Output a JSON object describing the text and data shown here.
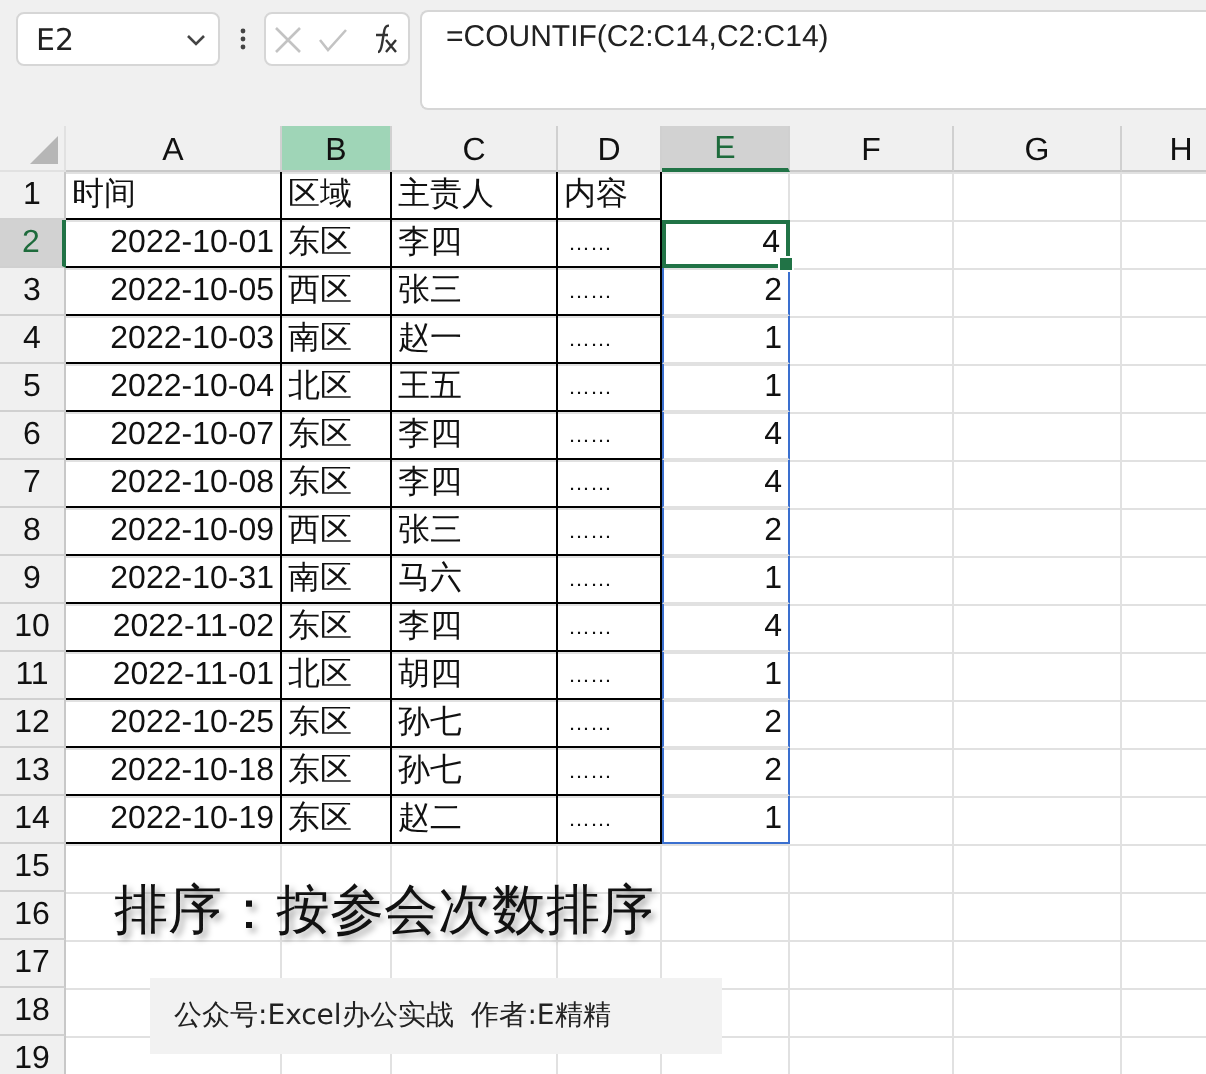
{
  "name_box": {
    "value": "E2"
  },
  "formula_bar": {
    "value": "=COUNTIF(C2:C14,C2:C14)"
  },
  "sheet": {
    "columns": [
      {
        "label": "A",
        "selected": false,
        "highlighted": false
      },
      {
        "label": "B",
        "selected": false,
        "highlighted": true
      },
      {
        "label": "C",
        "selected": false,
        "highlighted": false
      },
      {
        "label": "D",
        "selected": false,
        "highlighted": false
      },
      {
        "label": "E",
        "selected": true,
        "highlighted": false
      },
      {
        "label": "F",
        "selected": false,
        "highlighted": false
      },
      {
        "label": "G",
        "selected": false,
        "highlighted": false
      },
      {
        "label": "H",
        "selected": false,
        "highlighted": false
      }
    ],
    "rows": [
      {
        "number": "1",
        "selected": false,
        "cells": [
          "时间",
          "区域",
          "主责人",
          "内容"
        ]
      },
      {
        "number": "2",
        "selected": true,
        "cells": [
          "2022-10-01",
          "东区",
          "李四",
          "……",
          "4"
        ]
      },
      {
        "number": "3",
        "selected": false,
        "cells": [
          "2022-10-05",
          "西区",
          "张三",
          "……",
          "2"
        ]
      },
      {
        "number": "4",
        "selected": false,
        "cells": [
          "2022-10-03",
          "南区",
          "赵一",
          "……",
          "1"
        ]
      },
      {
        "number": "5",
        "selected": false,
        "cells": [
          "2022-10-04",
          "北区",
          "王五",
          "……",
          "1"
        ]
      },
      {
        "number": "6",
        "selected": false,
        "cells": [
          "2022-10-07",
          "东区",
          "李四",
          "……",
          "4"
        ]
      },
      {
        "number": "7",
        "selected": false,
        "cells": [
          "2022-10-08",
          "东区",
          "李四",
          "……",
          "4"
        ]
      },
      {
        "number": "8",
        "selected": false,
        "cells": [
          "2022-10-09",
          "西区",
          "张三",
          "……",
          "2"
        ]
      },
      {
        "number": "9",
        "selected": false,
        "cells": [
          "2022-10-31",
          "南区",
          "马六",
          "……",
          "1"
        ]
      },
      {
        "number": "10",
        "selected": false,
        "cells": [
          "2022-11-02",
          "东区",
          "李四",
          "……",
          "4"
        ]
      },
      {
        "number": "11",
        "selected": false,
        "cells": [
          "2022-11-01",
          "北区",
          "胡四",
          "……",
          "1"
        ]
      },
      {
        "number": "12",
        "selected": false,
        "cells": [
          "2022-10-25",
          "东区",
          "孙七",
          "……",
          "2"
        ]
      },
      {
        "number": "13",
        "selected": false,
        "cells": [
          "2022-10-18",
          "东区",
          "孙七",
          "……",
          "2"
        ]
      },
      {
        "number": "14",
        "selected": false,
        "cells": [
          "2022-10-19",
          "东区",
          "赵二",
          "……",
          "1"
        ]
      },
      {
        "number": "15",
        "selected": false
      },
      {
        "number": "16",
        "selected": false
      },
      {
        "number": "17",
        "selected": false
      },
      {
        "number": "18",
        "selected": false
      },
      {
        "number": "19",
        "selected": false
      }
    ]
  },
  "title": "排序：按参会次数排序",
  "credit": "公众号:Excel办公实战  作者:E精精"
}
